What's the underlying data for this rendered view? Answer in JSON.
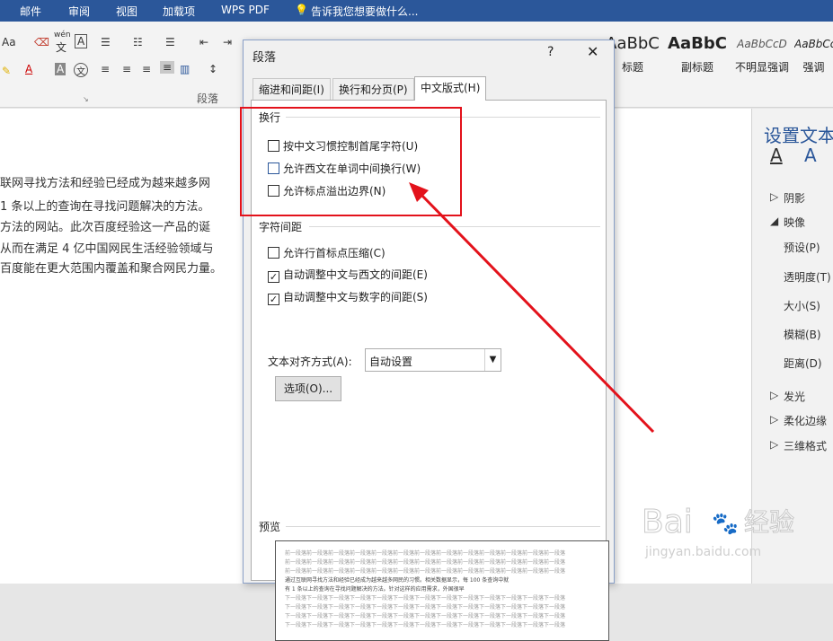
{
  "tabbar": {
    "tabs": [
      "邮件",
      "审阅",
      "视图",
      "加载项",
      "WPS PDF"
    ],
    "tell_me": "告诉我您想要做什么..."
  },
  "ribbon": {
    "font_size_label": "Aa",
    "wen_label": "wén",
    "wen_char": "文",
    "a_label": "A",
    "group_paragraph": "段落",
    "styles": [
      {
        "sample": "AaBbC",
        "name": "标题"
      },
      {
        "sample": "AaBbC",
        "name": "副标题"
      },
      {
        "sample": "AaBbCcD",
        "name": "不明显强调"
      },
      {
        "sample": "AaBbCc",
        "name": "强调"
      }
    ]
  },
  "document": {
    "lines": [
      "联网寻找方法和经验已经成为越来越多网",
      "1 条以上的查询在寻找问题解决的方法。",
      "方法的网站。此次百度经验这一产品的诞",
      "从而在满足 4 亿中国网民生活经验领域与",
      "百度能在更大范围内覆盖和聚合网民力量。"
    ]
  },
  "right_pane": {
    "title": "设置文本",
    "items": [
      "阴影",
      "映像",
      "预设(P)",
      "透明度(T)",
      "大小(S)",
      "模糊(B)",
      "距离(D)",
      "发光",
      "柔化边缘",
      "三维格式"
    ]
  },
  "dialog": {
    "title": "段落",
    "help": "?",
    "close": "✕",
    "tabs": [
      "缩进和间距(I)",
      "换行和分页(P)",
      "中文版式(H)"
    ],
    "section_wrap": "换行",
    "wrap_options": [
      {
        "label": "按中文习惯控制首尾字符(U)",
        "checked": false
      },
      {
        "label": "允许西文在单词中间换行(W)",
        "checked": false
      },
      {
        "label": "允许标点溢出边界(N)",
        "checked": false
      }
    ],
    "section_spacing": "字符间距",
    "spacing_options": [
      {
        "label": "允许行首标点压缩(C)",
        "checked": false
      },
      {
        "label": "自动调整中文与西文的间距(E)",
        "checked": true
      },
      {
        "label": "自动调整中文与数字的间距(S)",
        "checked": true
      }
    ],
    "align_label": "文本对齐方式(A):",
    "align_value": "自动设置",
    "options_button": "选项(O)...",
    "preview_label": "预览",
    "preview_prev": "前一段落前一段落前一段落前一段落前一段落前一段落前一段落前一段落前一段落前一段落前一段落前一段落前一段落",
    "preview_text_1": "通过互联网寻找方法和经验已经成为越来越多网民的习惯。相关数据显示，每 100 条查询中就",
    "preview_text_2": "有 1 条以上的查询在寻找问题解决的方法。针对这样的应用需求，外国很早",
    "preview_next": "下一段落下一段落下一段落下一段落下一段落下一段落下一段落下一段落下一段落下一段落下一段落下一段落下一段落"
  },
  "watermark": {
    "brand": "Bai 经验",
    "url": "jingyan.baidu.com"
  },
  "colors": {
    "accent": "#2b579a",
    "annotation": "#e3121b"
  }
}
